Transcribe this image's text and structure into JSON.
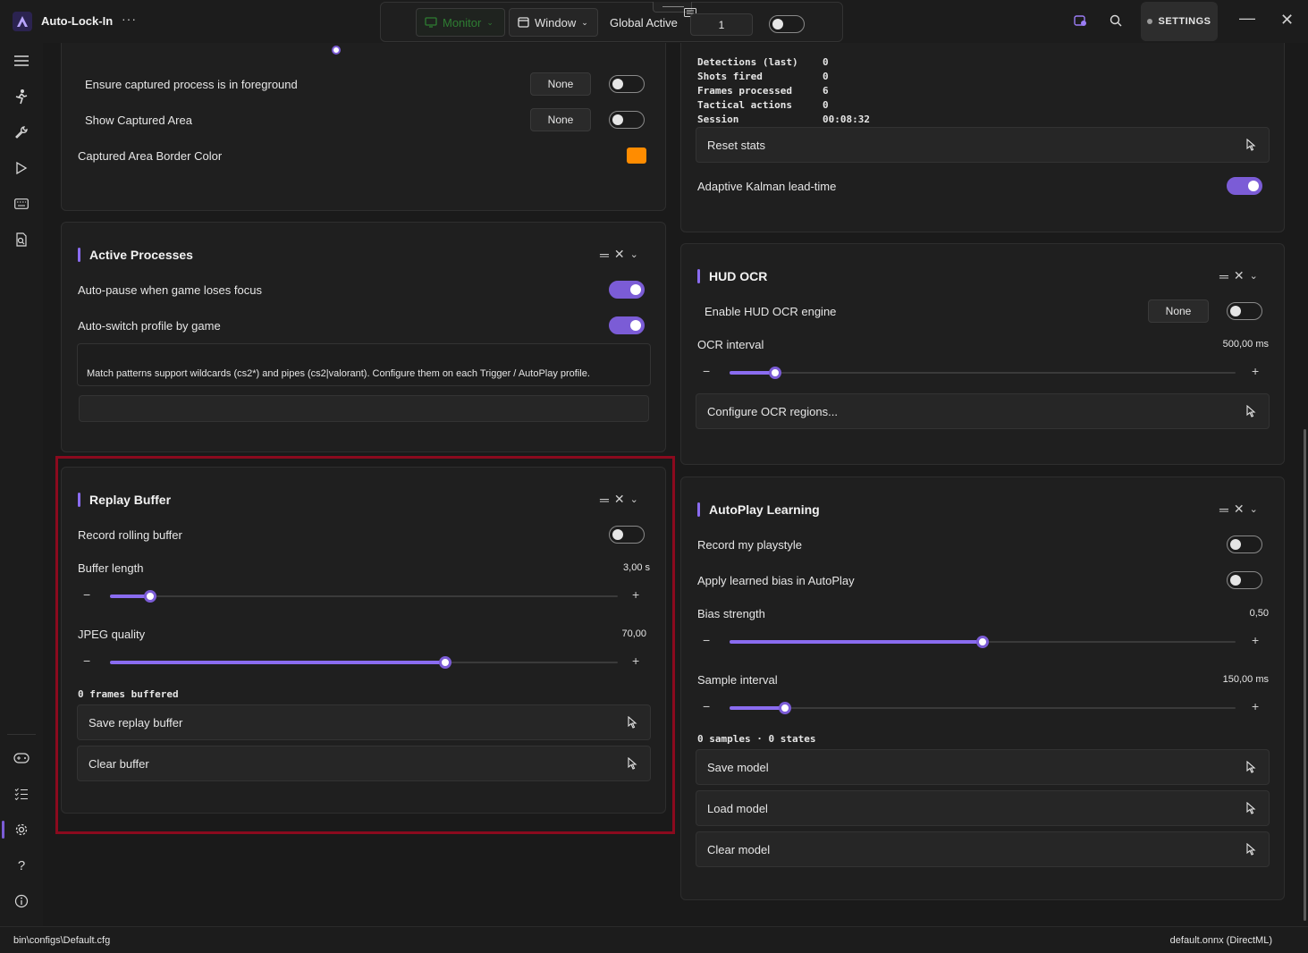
{
  "titlebar": {
    "app_title": "Auto-Lock-In",
    "more": "···",
    "monitor_label": "Monitor",
    "window_label": "Window",
    "global_label": "Global Active",
    "global_value": "1",
    "settings_label": "SETTINGS",
    "minimize": "—",
    "close": "✕"
  },
  "left": {
    "capture": {
      "ensure_foreground": {
        "label": "Ensure captured process is in foreground",
        "key": "None",
        "on": false
      },
      "show_area": {
        "label": "Show Captured Area",
        "key": "None",
        "on": false
      },
      "border_color": {
        "label": "Captured Area Border Color",
        "color": "#ff8c00"
      }
    },
    "active_processes": {
      "title": "Active Processes",
      "auto_pause": {
        "label": "Auto-pause when game loses focus",
        "on": true
      },
      "auto_switch": {
        "label": "Auto-switch profile by game",
        "on": true
      },
      "info": "Match patterns support wildcards (cs2*) and pipes (cs2|valorant). Configure them on each Trigger / AutoPlay profile."
    },
    "replay_buffer": {
      "title": "Replay Buffer",
      "record": {
        "label": "Record rolling buffer",
        "on": false
      },
      "buffer_length": {
        "label": "Buffer length",
        "value": "3,00 s",
        "level": 0.08
      },
      "jpeg_quality": {
        "label": "JPEG quality",
        "value": "70,00",
        "level": 0.66
      },
      "frames": "0 frames buffered",
      "save": "Save replay buffer",
      "clear": "Clear buffer"
    }
  },
  "right": {
    "stats": {
      "rows": [
        {
          "label": "Detections (last)",
          "value": "0"
        },
        {
          "label": "Shots fired",
          "value": "0"
        },
        {
          "label": "Frames processed",
          "value": "6"
        },
        {
          "label": "Tactical actions",
          "value": "0"
        },
        {
          "label": "Session",
          "value": "00:08:32"
        }
      ],
      "reset": "Reset stats",
      "kalman": {
        "label": "Adaptive Kalman lead-time",
        "on": true
      }
    },
    "hud_ocr": {
      "title": "HUD OCR",
      "enable": {
        "label": "Enable HUD OCR engine",
        "key": "None",
        "on": false
      },
      "interval": {
        "label": "OCR interval",
        "value": "500,00 ms",
        "level": 0.09
      },
      "configure": "Configure OCR regions..."
    },
    "autoplay": {
      "title": "AutoPlay Learning",
      "record": {
        "label": "Record my playstyle",
        "on": false
      },
      "apply": {
        "label": "Apply learned bias in AutoPlay",
        "on": false
      },
      "bias": {
        "label": "Bias strength",
        "value": "0,50",
        "level": 0.5
      },
      "sample": {
        "label": "Sample interval",
        "value": "150,00 ms",
        "level": 0.11
      },
      "summary": "0 samples · 0 states",
      "save": "Save model",
      "load": "Load model",
      "clear": "Clear model"
    }
  },
  "status": {
    "config_path": "bin\\configs\\Default.cfg",
    "model": "default.onnx (DirectML)"
  },
  "colors": {
    "accent": "#7b5cd6",
    "highlight": "#8b0a1e",
    "swatch": "#ff8c00"
  }
}
